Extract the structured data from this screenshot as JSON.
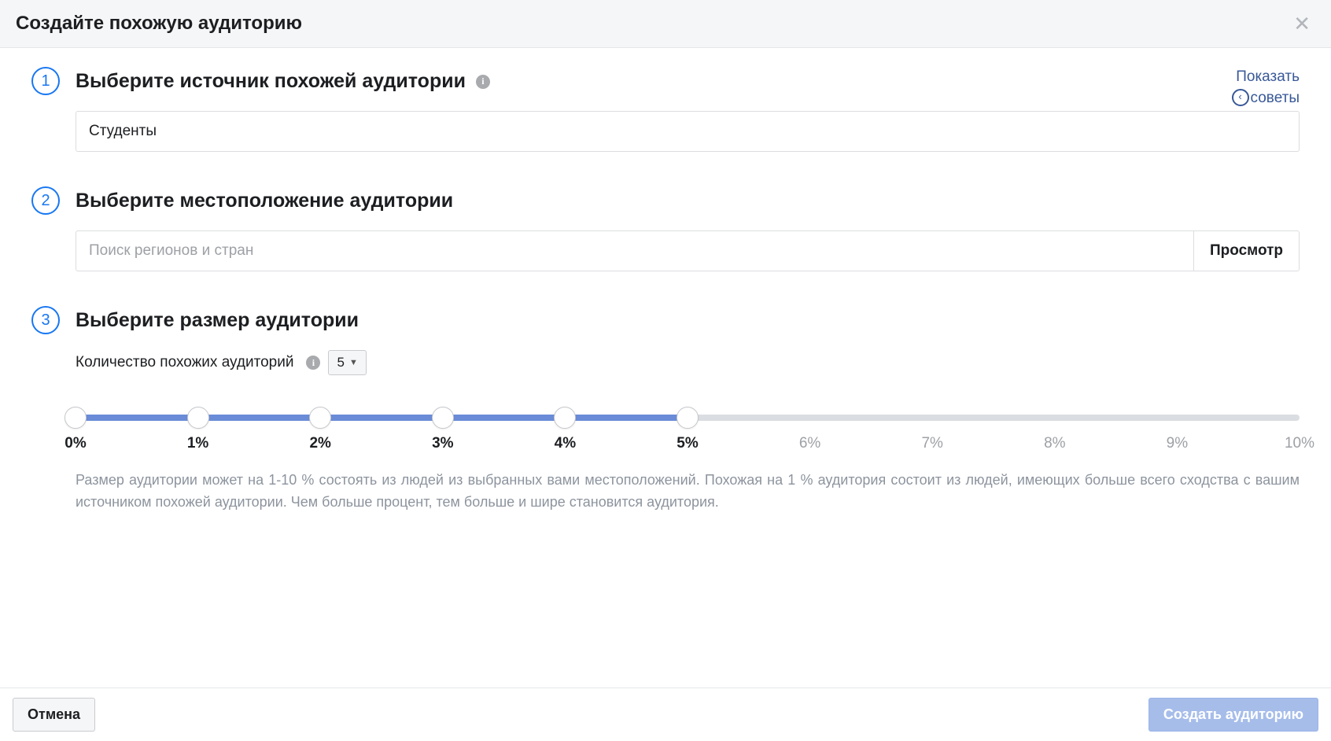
{
  "modal": {
    "title": "Создайте похожую аудиторию"
  },
  "tips": {
    "line1": "Показать",
    "line2": "советы"
  },
  "steps": {
    "s1": {
      "num": "1",
      "title": "Выберите источник похожей аудитории",
      "source_value": "Студенты"
    },
    "s2": {
      "num": "2",
      "title": "Выберите местоположение аудитории",
      "placeholder": "Поиск регионов и стран",
      "browse": "Просмотр"
    },
    "s3": {
      "num": "3",
      "title": "Выберите размер аудитории",
      "count_label": "Количество похожих аудиторий",
      "count_value": "5",
      "slider": {
        "fill_percent": 50,
        "handles": [
          0,
          10,
          20,
          30,
          40,
          50
        ],
        "labels": [
          {
            "t": "0%",
            "pos": 0,
            "muted": false
          },
          {
            "t": "1%",
            "pos": 10,
            "muted": false
          },
          {
            "t": "2%",
            "pos": 20,
            "muted": false
          },
          {
            "t": "3%",
            "pos": 30,
            "muted": false
          },
          {
            "t": "4%",
            "pos": 40,
            "muted": false
          },
          {
            "t": "5%",
            "pos": 50,
            "muted": false
          },
          {
            "t": "6%",
            "pos": 60,
            "muted": true
          },
          {
            "t": "7%",
            "pos": 70,
            "muted": true
          },
          {
            "t": "8%",
            "pos": 80,
            "muted": true
          },
          {
            "t": "9%",
            "pos": 90,
            "muted": true
          },
          {
            "t": "10%",
            "pos": 100,
            "muted": true
          }
        ]
      },
      "desc": "Размер аудитории может на 1-10 % состоять из людей из выбранных вами местоположений. Похожая на 1 % аудитория состоит из людей, имеющих больше всего сходства с вашим источником похожей аудитории. Чем больше процент, тем больше и шире становится аудитория."
    }
  },
  "footer": {
    "cancel": "Отмена",
    "create": "Создать аудиторию"
  }
}
